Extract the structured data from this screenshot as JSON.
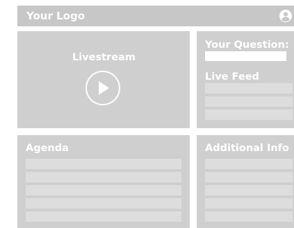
{
  "header": {
    "logo_text": "Your Logo",
    "user_icon": "user-circle-icon"
  },
  "livestream": {
    "title": "Livestream",
    "play_icon": "play-circle-icon"
  },
  "question": {
    "title": "Your Question:",
    "input_value": "",
    "input_placeholder": ""
  },
  "live_feed": {
    "title": "Live Feed",
    "item_count": 3
  },
  "agenda": {
    "title": "Agenda",
    "item_count": 5
  },
  "additional_info": {
    "title": "Additional Info",
    "item_count": 5
  },
  "colors": {
    "header_bg": "#c7c7c7",
    "panel_bg": "#cfcfcf",
    "placeholder_bar": "#dddddd",
    "text": "#ffffff"
  }
}
